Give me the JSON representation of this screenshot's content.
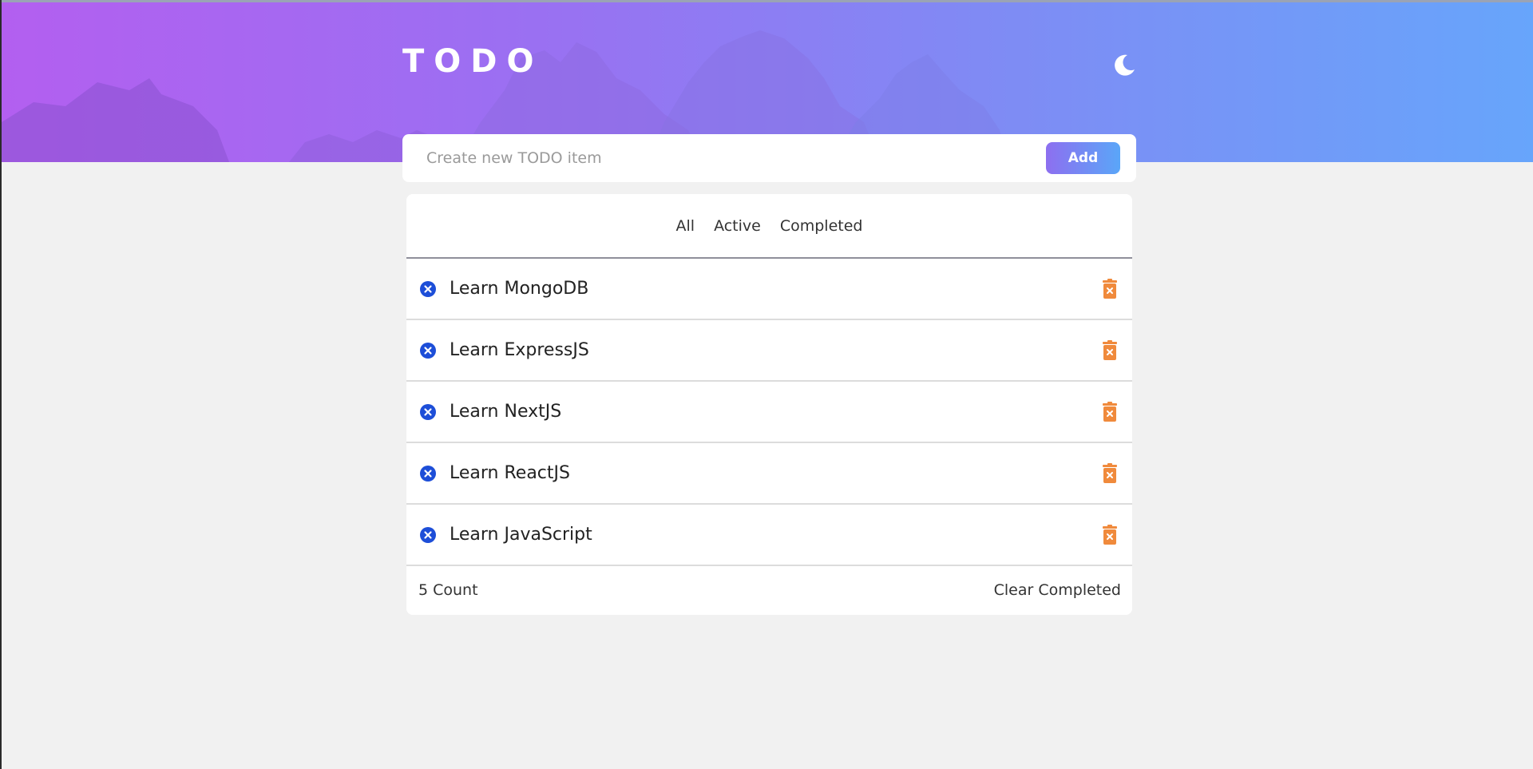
{
  "header": {
    "title": "TODO",
    "theme_icon": "moon-icon"
  },
  "new_item": {
    "placeholder": "Create new TODO item",
    "value": "",
    "add_label": "Add"
  },
  "filters": [
    {
      "label": "All"
    },
    {
      "label": "Active"
    },
    {
      "label": "Completed"
    }
  ],
  "todos": [
    {
      "text": "Learn MongoDB",
      "status_icon": "x-circle-icon",
      "delete_icon": "trash-icon"
    },
    {
      "text": "Learn ExpressJS",
      "status_icon": "x-circle-icon",
      "delete_icon": "trash-icon"
    },
    {
      "text": "Learn NextJS",
      "status_icon": "x-circle-icon",
      "delete_icon": "trash-icon"
    },
    {
      "text": "Learn ReactJS",
      "status_icon": "x-circle-icon",
      "delete_icon": "trash-icon"
    },
    {
      "text": "Learn JavaScript",
      "status_icon": "x-circle-icon",
      "delete_icon": "trash-icon"
    }
  ],
  "footer": {
    "count": "5 Count",
    "clear_label": "Clear Completed"
  },
  "colors": {
    "gradient_start": "#b35ff0",
    "gradient_end": "#67a5fb",
    "status_icon": "#1d4ed8",
    "delete_icon": "#f08a3c",
    "background": "#f1f1f1"
  }
}
